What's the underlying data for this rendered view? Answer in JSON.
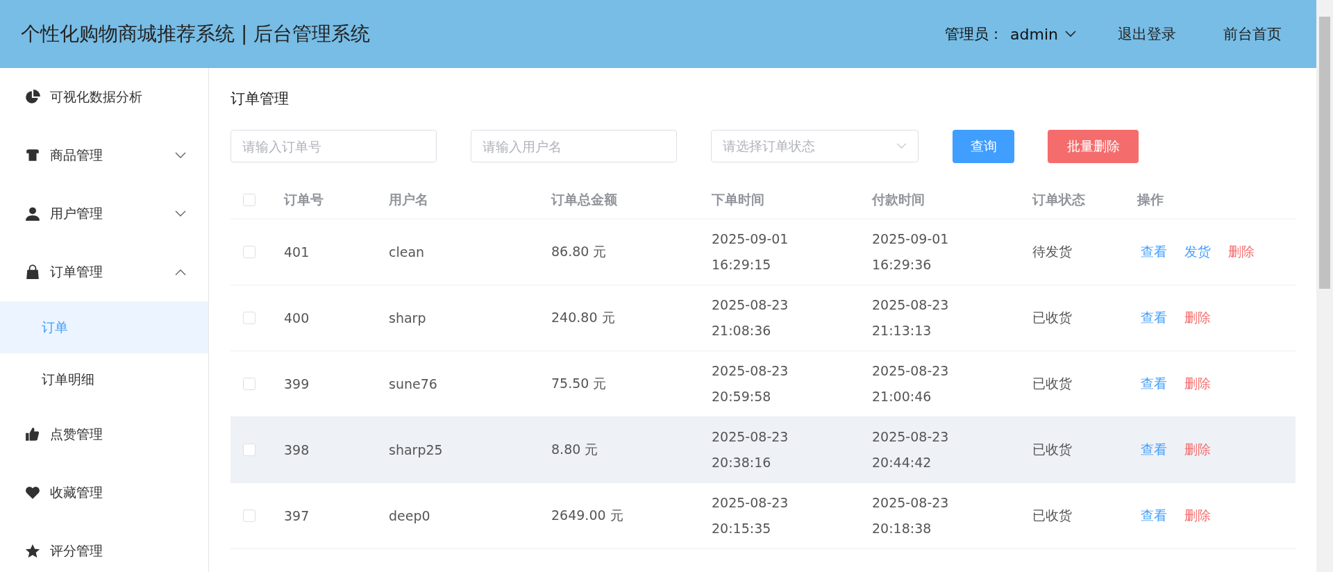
{
  "header": {
    "title": "个性化购物商城推荐系统 | 后台管理系统",
    "admin_label": "管理员：",
    "admin_name": "admin",
    "links": [
      "退出登录",
      "前台首页"
    ]
  },
  "sidebar": {
    "items": [
      {
        "label": "可视化数据分析",
        "selected": false
      },
      {
        "label": "商品管理",
        "expanded": false
      },
      {
        "label": "用户管理",
        "expanded": false
      },
      {
        "label": "订单管理",
        "expanded": true,
        "children": [
          {
            "label": "订单",
            "selected": true
          },
          {
            "label": "订单明细",
            "selected": false
          }
        ]
      },
      {
        "label": "点赞管理",
        "selected": false
      },
      {
        "label": "收藏管理",
        "selected": false
      },
      {
        "label": "评分管理",
        "selected": false
      }
    ]
  },
  "page_title": "订单管理",
  "filters": {
    "order_no": {
      "placeholder": "请输入订单号"
    },
    "username": {
      "placeholder": "请输入用户名"
    },
    "status": {
      "placeholder": "请选择订单状态"
    },
    "buttons": [
      {
        "label": "查询",
        "kind": "primary"
      },
      {
        "label": "批量删除",
        "kind": "danger"
      }
    ]
  },
  "table": {
    "select_all_checked": false,
    "columns": [
      "订单号",
      "用户名",
      "订单总金额",
      "下单时间",
      "付款时间",
      "订单状态",
      "操作"
    ],
    "rows": [
      {
        "checked": false,
        "highlighted": false,
        "id": "401",
        "user": "clean",
        "amount": "86.80 元",
        "order_time": [
          "2025-09-01",
          "16:29:15"
        ],
        "pay_time": [
          "2025-09-01",
          "16:29:36"
        ],
        "status": "待发货",
        "actions": [
          {
            "label": "查看",
            "kind": "view"
          },
          {
            "label": "发货",
            "kind": "ship"
          },
          {
            "label": "删除",
            "kind": "delete"
          }
        ]
      },
      {
        "checked": false,
        "highlighted": false,
        "id": "400",
        "user": "sharp",
        "amount": "240.80 元",
        "order_time": [
          "2025-08-23",
          "21:08:36"
        ],
        "pay_time": [
          "2025-08-23",
          "21:13:13"
        ],
        "status": "已收货",
        "actions": [
          {
            "label": "查看",
            "kind": "view"
          },
          {
            "label": "删除",
            "kind": "delete"
          }
        ]
      },
      {
        "checked": false,
        "highlighted": false,
        "id": "399",
        "user": "sune76",
        "amount": "75.50 元",
        "order_time": [
          "2025-08-23",
          "20:59:58"
        ],
        "pay_time": [
          "2025-08-23",
          "21:00:46"
        ],
        "status": "已收货",
        "actions": [
          {
            "label": "查看",
            "kind": "view"
          },
          {
            "label": "删除",
            "kind": "delete"
          }
        ]
      },
      {
        "checked": false,
        "highlighted": true,
        "id": "398",
        "user": "sharp25",
        "amount": "8.80 元",
        "order_time": [
          "2025-08-23",
          "20:38:16"
        ],
        "pay_time": [
          "2025-08-23",
          "20:44:42"
        ],
        "status": "已收货",
        "actions": [
          {
            "label": "查看",
            "kind": "view"
          },
          {
            "label": "删除",
            "kind": "delete"
          }
        ]
      },
      {
        "checked": false,
        "highlighted": false,
        "id": "397",
        "user": "deep0",
        "amount": "2649.00 元",
        "order_time": [
          "2025-08-23",
          "20:15:35"
        ],
        "pay_time": [
          "2025-08-23",
          "20:18:38"
        ],
        "status": "已收货",
        "actions": [
          {
            "label": "查看",
            "kind": "view"
          },
          {
            "label": "删除",
            "kind": "delete"
          }
        ]
      }
    ]
  }
}
